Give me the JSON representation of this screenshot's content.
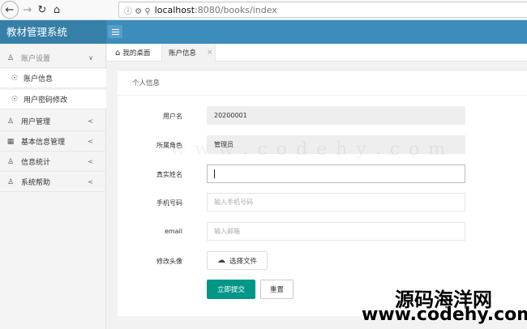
{
  "browser": {
    "url_host": "localhost",
    "url_path": ":8080/books/index"
  },
  "app": {
    "title": "教材管理系统"
  },
  "sidebar": {
    "items": [
      {
        "label": "账户设置",
        "icon": "user-icon",
        "expanded": true
      },
      {
        "label": "账户信息",
        "icon": "user-circle-icon"
      },
      {
        "label": "用户密码修改",
        "icon": "user-circle-icon"
      },
      {
        "label": "用户管理",
        "icon": "user-icon"
      },
      {
        "label": "基本信息管理",
        "icon": "book-icon"
      },
      {
        "label": "信息统计",
        "icon": "user-icon"
      },
      {
        "label": "系统帮助",
        "icon": "user-icon"
      }
    ]
  },
  "tabs": [
    {
      "label": "我的桌面",
      "icon": "home-icon"
    },
    {
      "label": "账户信息",
      "active": true
    }
  ],
  "form": {
    "title": "个人信息",
    "username": {
      "label": "用户名",
      "value": "20200001"
    },
    "role": {
      "label": "所属角色",
      "value": "管理员"
    },
    "realname": {
      "label": "真实姓名",
      "value": ""
    },
    "phone": {
      "label": "手机号码",
      "placeholder": "输入手机号码"
    },
    "email": {
      "label": "email",
      "placeholder": "输入邮箱"
    },
    "avatar": {
      "label": "修改头像",
      "button": "选择文件"
    },
    "submit_label": "立即提交",
    "reset_label": "重置"
  },
  "watermark": {
    "faint_text": "w w w . c o d e h y . c o m",
    "cn_text": "源码海洋网",
    "url_text": "www.codehy.com"
  },
  "colors": {
    "header": "#3c8dbc",
    "header_logo": "#367fa9",
    "submit": "#009688"
  }
}
